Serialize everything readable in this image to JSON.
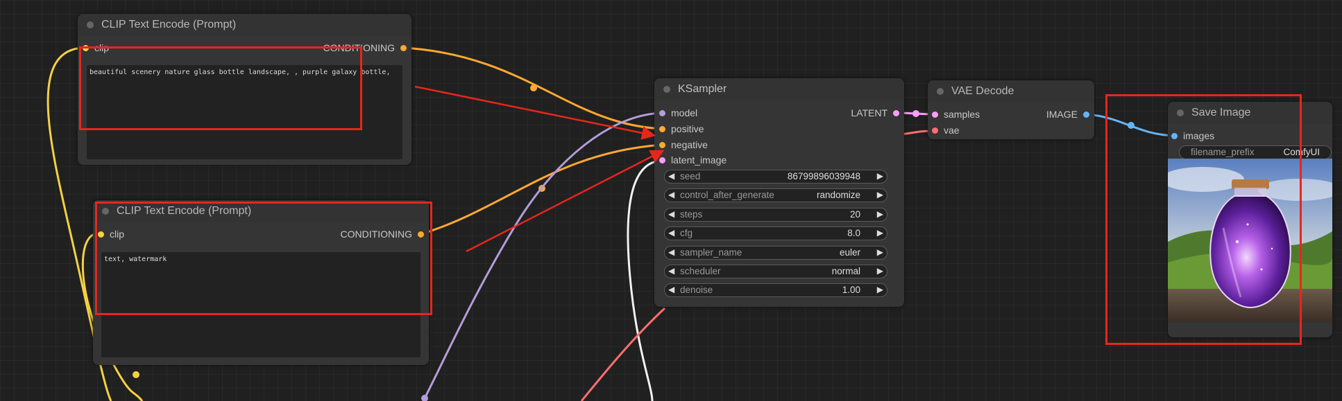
{
  "nodes": {
    "clip_top": {
      "title": "CLIP Text Encode (Prompt)",
      "input": "clip",
      "output": "CONDITIONING",
      "text": "beautiful scenery nature glass bottle landscape, , purple galaxy bottle,"
    },
    "clip_bottom": {
      "title": "CLIP Text Encode (Prompt)",
      "input": "clip",
      "output": "CONDITIONING",
      "text": "text, watermark"
    },
    "ksampler": {
      "title": "KSampler",
      "inputs": [
        "model",
        "positive",
        "negative",
        "latent_image"
      ],
      "output": "LATENT",
      "widgets": [
        {
          "label": "seed",
          "value": "86799896039948"
        },
        {
          "label": "control_after_generate",
          "value": "randomize"
        },
        {
          "label": "steps",
          "value": "20"
        },
        {
          "label": "cfg",
          "value": "8.0"
        },
        {
          "label": "sampler_name",
          "value": "euler"
        },
        {
          "label": "scheduler",
          "value": "normal"
        },
        {
          "label": "denoise",
          "value": "1.00"
        }
      ]
    },
    "vae_decode": {
      "title": "VAE Decode",
      "inputs": [
        "samples",
        "vae"
      ],
      "output": "IMAGE"
    },
    "save_image": {
      "title": "Save Image",
      "input": "images",
      "widget": {
        "label": "filename_prefix",
        "value": "ComfyUI"
      }
    }
  },
  "colors": {
    "clip": "#f5d142",
    "conditioning": "#ffa931",
    "model": "#b39ddb",
    "latent": "#ff9cf9",
    "vae": "#ff6e6e",
    "image": "#64b5f6",
    "annotation": "#e8261c"
  }
}
